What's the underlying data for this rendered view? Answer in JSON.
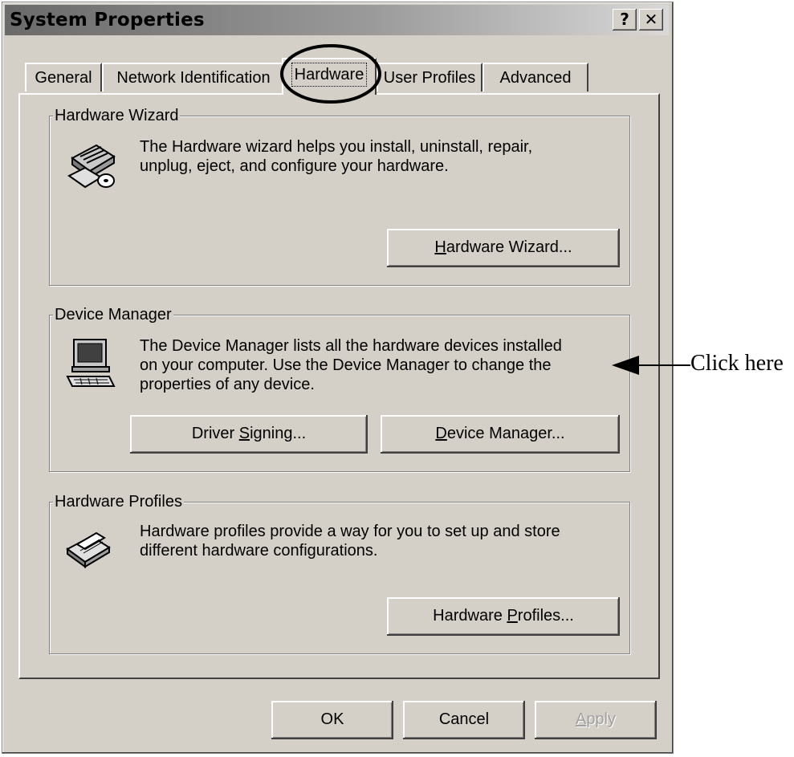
{
  "window": {
    "title": "System Properties",
    "help_glyph": "?",
    "close_glyph": "✕"
  },
  "tabs": [
    {
      "label": "General"
    },
    {
      "label": "Network Identification"
    },
    {
      "label": "Hardware"
    },
    {
      "label": "User Profiles"
    },
    {
      "label": "Advanced"
    }
  ],
  "hardware_wizard": {
    "title": "Hardware Wizard",
    "text_1": "The Hardware wizard helps you install, uninstall, repair,",
    "text_2": "unplug, eject, and configure your hardware.",
    "button_pre": "",
    "button_ul": "H",
    "button_post": "ardware Wizard..."
  },
  "device_manager": {
    "title": "Device Manager",
    "text_1": "The Device Manager lists all the hardware devices installed",
    "text_2": "on your computer. Use the Device Manager to change the",
    "text_3": "properties of any device.",
    "signing_pre": "Driver ",
    "signing_ul": "S",
    "signing_post": "igning...",
    "dm_pre": "",
    "dm_ul": "D",
    "dm_post": "evice Manager..."
  },
  "hardware_profiles": {
    "title": "Hardware Profiles",
    "text_1": "Hardware profiles provide a way for you to set up and store",
    "text_2": "different hardware configurations.",
    "button_pre": "Hardware ",
    "button_ul": "P",
    "button_post": "rofiles..."
  },
  "footer": {
    "ok": "OK",
    "cancel": "Cancel",
    "apply_ul": "A",
    "apply_post": "pply"
  },
  "annotation": {
    "text": "Click here"
  }
}
